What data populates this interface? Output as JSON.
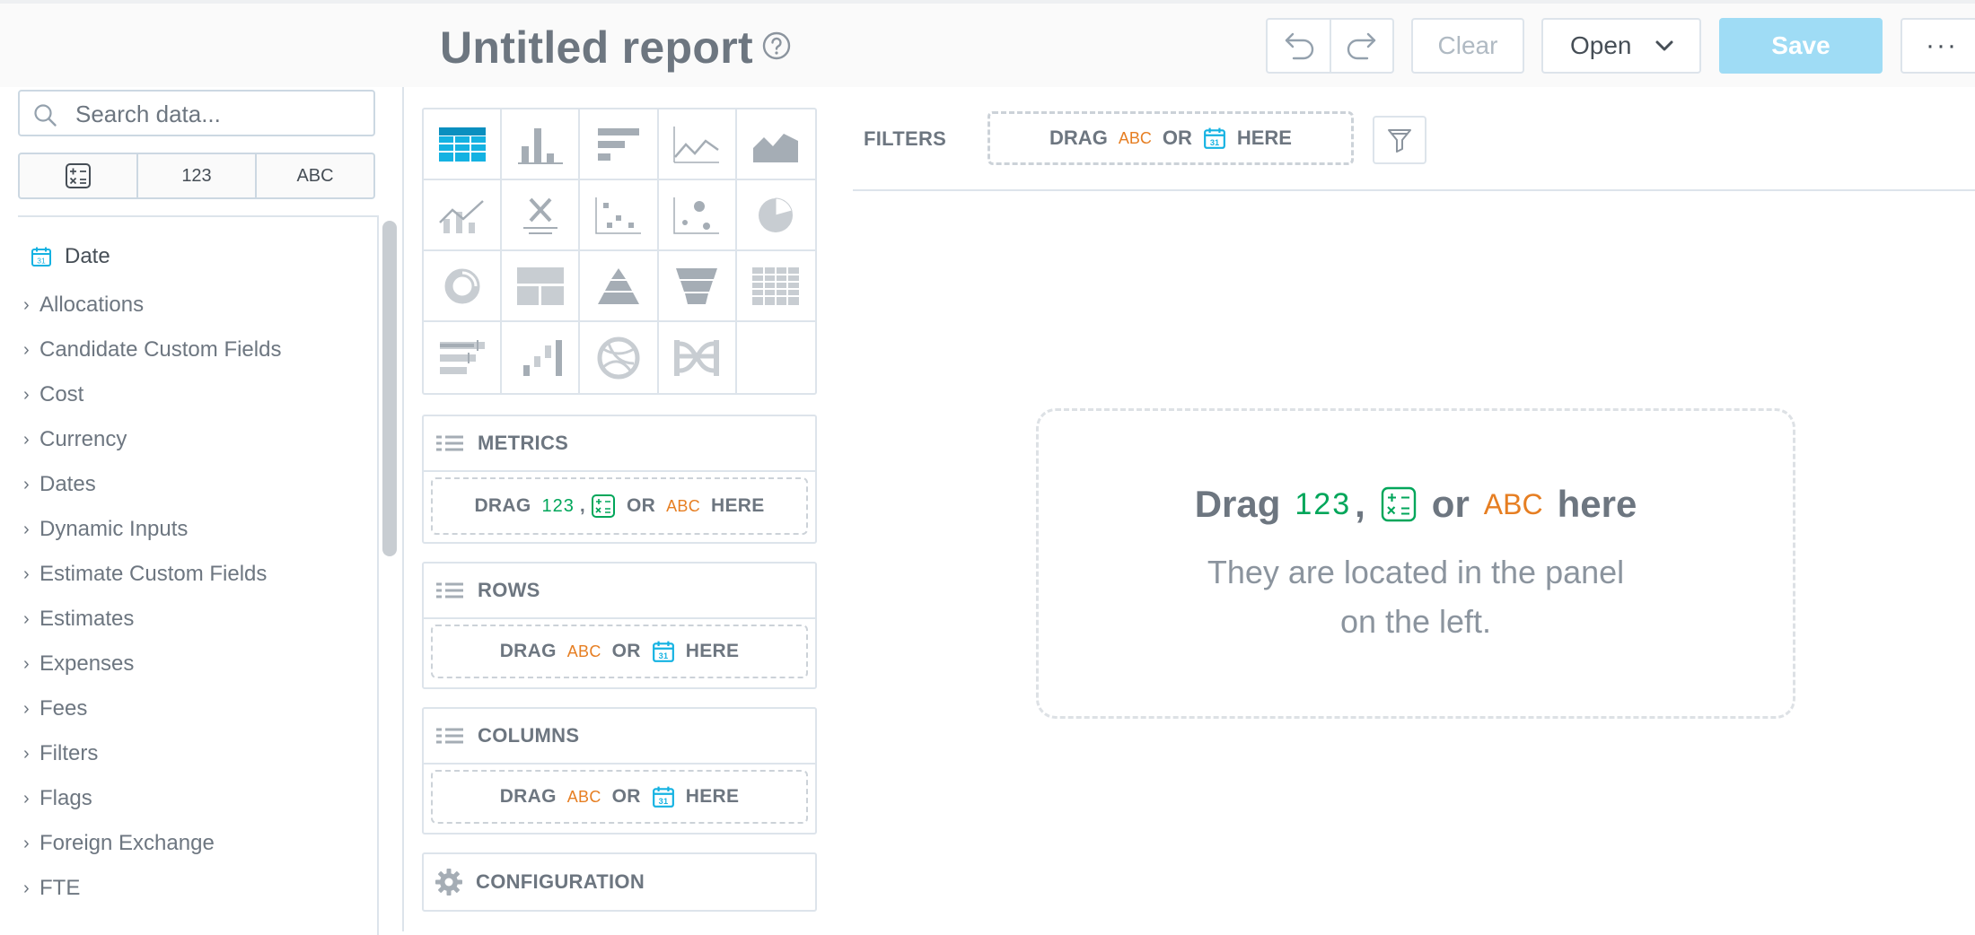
{
  "header": {
    "title": "Untitled report",
    "clear_label": "Clear",
    "open_label": "Open",
    "save_label": "Save",
    "more_label": "···"
  },
  "catalog": {
    "search_placeholder": "Search data...",
    "type_filters": [
      "123",
      "ABC"
    ],
    "date_label": "Date",
    "items": [
      "Allocations",
      "Candidate Custom Fields",
      "Cost",
      "Currency",
      "Dates",
      "Dynamic Inputs",
      "Estimate Custom Fields",
      "Estimates",
      "Expenses",
      "Fees",
      "Filters",
      "Flags",
      "Foreign Exchange",
      "FTE"
    ]
  },
  "buckets": {
    "metrics": {
      "title": "METRICS",
      "drag": "DRAG",
      "num": "123",
      "comma": ",",
      "or": "OR",
      "abc": "ABC",
      "here": "HERE"
    },
    "rows": {
      "title": "ROWS",
      "drag": "DRAG",
      "abc": "ABC",
      "or": "OR",
      "here": "HERE"
    },
    "columns": {
      "title": "COLUMNS",
      "drag": "DRAG",
      "abc": "ABC",
      "or": "OR",
      "here": "HERE"
    },
    "configuration": {
      "title": "CONFIGURATION"
    }
  },
  "filters": {
    "label": "FILTERS",
    "drag": "DRAG",
    "abc": "ABC",
    "or": "OR",
    "here": "HERE"
  },
  "canvas": {
    "drag": "Drag",
    "num": "123",
    "comma": ",",
    "or": "or",
    "abc": "ABC",
    "here": "here",
    "hint_line1": "They are located in the panel",
    "hint_line2": "on the left."
  },
  "colors": {
    "accent": "#14b2e2",
    "save_bg": "#9fdcf5",
    "number": "#00a65a",
    "text_attr": "#e67e22",
    "date": "#14b2e2",
    "border": "#dde4eb"
  }
}
